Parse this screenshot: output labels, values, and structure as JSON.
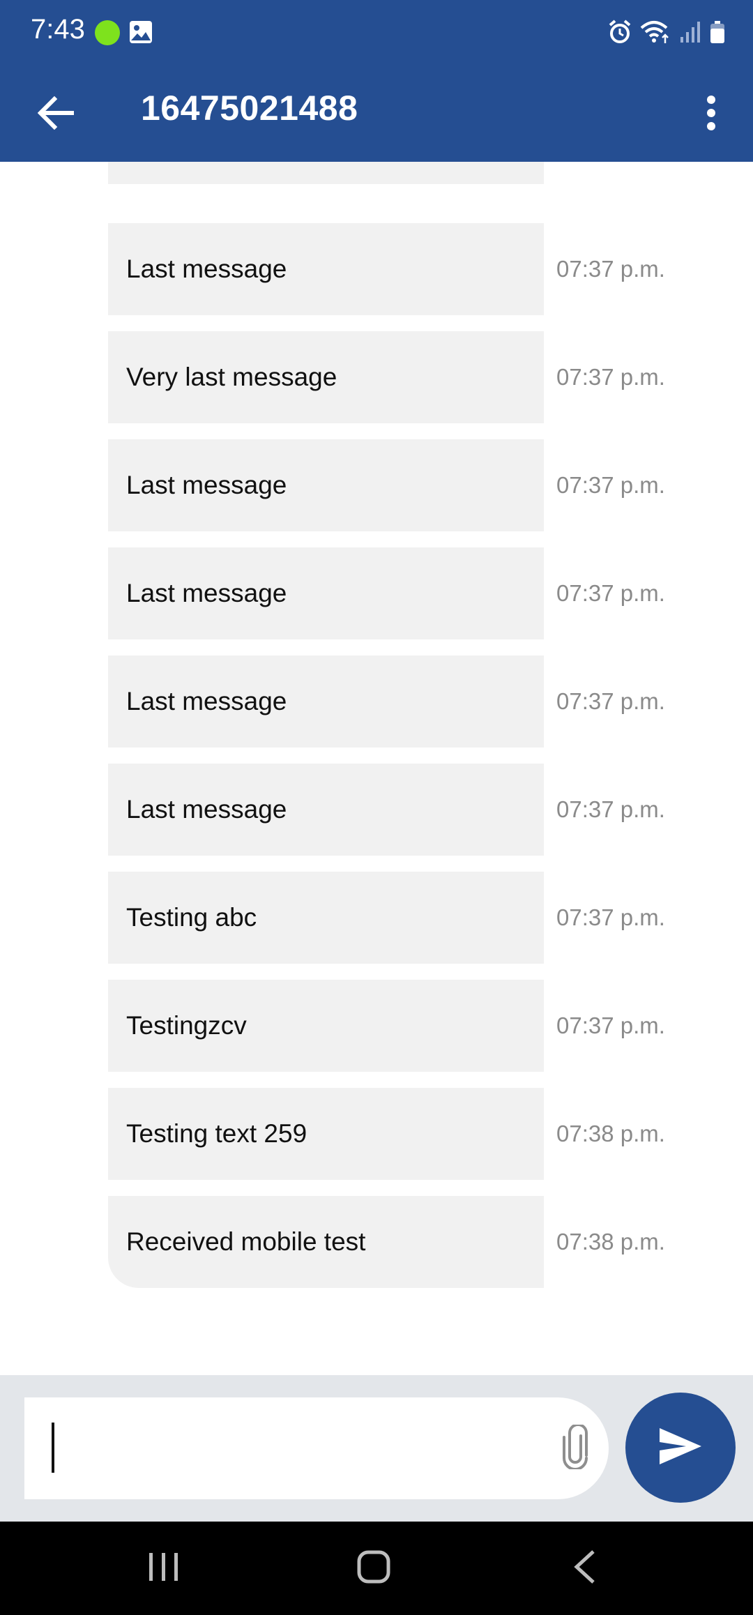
{
  "status_bar": {
    "time": "7:43",
    "notification_dot_color": "#7ee21d",
    "icons": [
      "gallery-icon",
      "alarm-icon",
      "wifi-icon",
      "signal-icon",
      "battery-icon"
    ]
  },
  "app_bar": {
    "title": "16475021488",
    "color": "#254e92",
    "back_icon": "arrow-back-icon",
    "menu_icon": "more-vert-icon"
  },
  "messages": [
    {
      "text": "Last message",
      "time": "07:37 p.m."
    },
    {
      "text": "Very last message",
      "time": "07:37 p.m."
    },
    {
      "text": "Last message",
      "time": "07:37 p.m."
    },
    {
      "text": "Last message",
      "time": "07:37 p.m."
    },
    {
      "text": "Last message",
      "time": "07:37 p.m."
    },
    {
      "text": "Last message",
      "time": "07:37 p.m."
    },
    {
      "text": "Testing abc",
      "time": "07:37 p.m."
    },
    {
      "text": "Testingzcv",
      "time": "07:37 p.m."
    },
    {
      "text": "Testing text 259",
      "time": "07:38 p.m."
    },
    {
      "text": "Received mobile test",
      "time": "07:38 p.m."
    }
  ],
  "composer": {
    "value": "",
    "placeholder": "",
    "attach_icon": "paperclip-icon",
    "send_icon": "send-icon"
  },
  "nav_bar": {
    "icons": [
      "recent-apps-icon",
      "home-icon",
      "back-icon"
    ]
  }
}
